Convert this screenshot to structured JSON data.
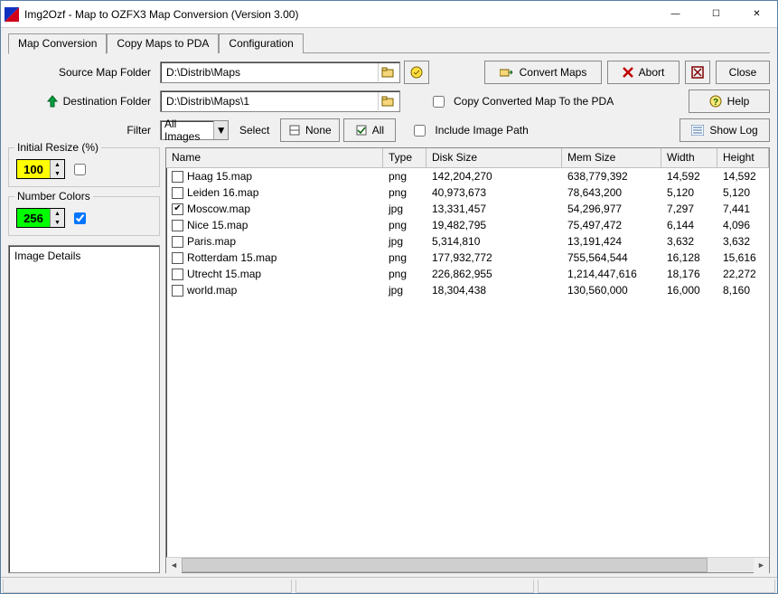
{
  "window": {
    "title": "Img2Ozf - Map to OZFX3 Map Conversion (Version 3.00)"
  },
  "tabs": [
    {
      "label": "Map Conversion",
      "active": true
    },
    {
      "label": "Copy Maps to PDA",
      "active": false
    },
    {
      "label": "Configuration",
      "active": false
    }
  ],
  "labels": {
    "source": "Source Map Folder",
    "dest": "Destination Folder",
    "filter": "Filter",
    "select": "Select",
    "none": "None",
    "all": "All",
    "convert": "Convert Maps",
    "abort": "Abort",
    "close": "Close",
    "help": "Help",
    "showlog": "Show Log",
    "copy_converted": "Copy Converted Map To the PDA",
    "include_path": "Include Image Path",
    "initial_resize": "Initial Resize (%)",
    "number_colors": "Number Colors",
    "image_details": "Image Details"
  },
  "paths": {
    "source": "D:\\Distrib\\Maps",
    "dest": "D:\\Distrib\\Maps\\1"
  },
  "filter_selected": "All Images",
  "resize_value": "100",
  "colors_value": "256",
  "copy_to_pda_checked": false,
  "include_path_checked": false,
  "resize_extra_checked": false,
  "colors_extra_checked": true,
  "columns": {
    "name": "Name",
    "type": "Type",
    "disk": "Disk Size",
    "mem": "Mem Size",
    "width": "Width",
    "height": "Height"
  },
  "rows": [
    {
      "checked": false,
      "name": "Haag 15.map",
      "type": "png",
      "disk": "142,204,270",
      "mem": "638,779,392",
      "width": "14,592",
      "height": "14,592"
    },
    {
      "checked": false,
      "name": "Leiden 16.map",
      "type": "png",
      "disk": "40,973,673",
      "mem": "78,643,200",
      "width": "5,120",
      "height": "5,120"
    },
    {
      "checked": true,
      "name": "Moscow.map",
      "type": "jpg",
      "disk": "13,331,457",
      "mem": "54,296,977",
      "width": "7,297",
      "height": "7,441"
    },
    {
      "checked": false,
      "name": "Nice 15.map",
      "type": "png",
      "disk": "19,482,795",
      "mem": "75,497,472",
      "width": "6,144",
      "height": "4,096"
    },
    {
      "checked": false,
      "name": "Paris.map",
      "type": "jpg",
      "disk": "5,314,810",
      "mem": "13,191,424",
      "width": "3,632",
      "height": "3,632"
    },
    {
      "checked": false,
      "name": "Rotterdam 15.map",
      "type": "png",
      "disk": "177,932,772",
      "mem": "755,564,544",
      "width": "16,128",
      "height": "15,616"
    },
    {
      "checked": false,
      "name": "Utrecht 15.map",
      "type": "png",
      "disk": "226,862,955",
      "mem": "1,214,447,616",
      "width": "18,176",
      "height": "22,272"
    },
    {
      "checked": false,
      "name": "world.map",
      "type": "jpg",
      "disk": "18,304,438",
      "mem": "130,560,000",
      "width": "16,000",
      "height": "8,160"
    }
  ]
}
